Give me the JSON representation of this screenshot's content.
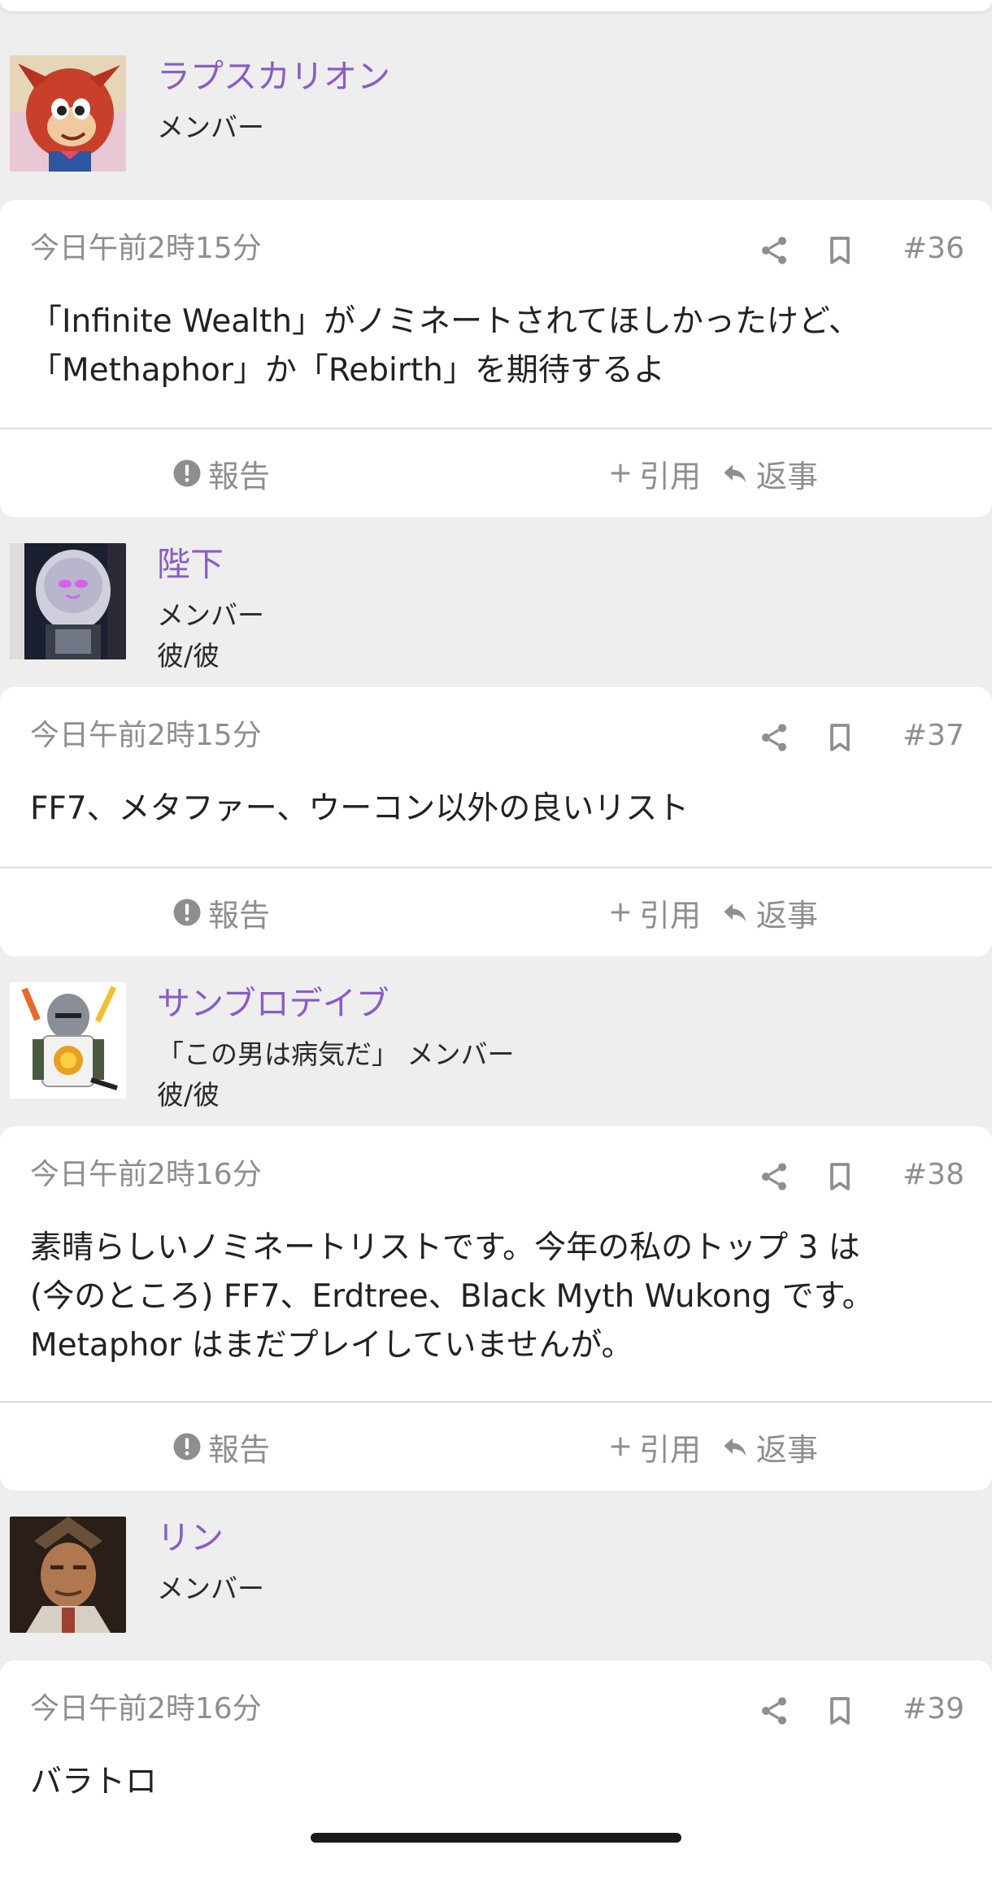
{
  "actions": {
    "report": "報告",
    "quote": "引用",
    "reply": "返事"
  },
  "posts": [
    {
      "author": "ラプスカリオン",
      "role": "メンバー",
      "pronoun": "",
      "date": "今日午前2時15分",
      "number": "#36",
      "body": [
        "「Infinite Wealth」がノミネートされてほしかったけど、",
        "「Methaphor」か「Rebirth」を期待するよ"
      ]
    },
    {
      "author": "陛下",
      "role": "メンバー",
      "pronoun": "彼/彼",
      "date": "今日午前2時15分",
      "number": "#37",
      "body": [
        "FF7、メタファー、ウーコン以外の良いリスト"
      ]
    },
    {
      "author": "サンブロデイブ",
      "role": "「この男は病気だ」 メンバー",
      "pronoun": "彼/彼",
      "date": "今日午前2時16分",
      "number": "#38",
      "body": [
        "素晴らしいノミネートリストです。今年の私のトップ 3 は",
        "(今のところ) FF7、Erdtree、Black Myth Wukong です。",
        "Metaphor はまだプレイしていませんが。"
      ]
    },
    {
      "author": "リン",
      "role": "メンバー",
      "pronoun": "",
      "date": "今日午前2時16分",
      "number": "#39",
      "body": [
        "バラトロ"
      ]
    }
  ]
}
